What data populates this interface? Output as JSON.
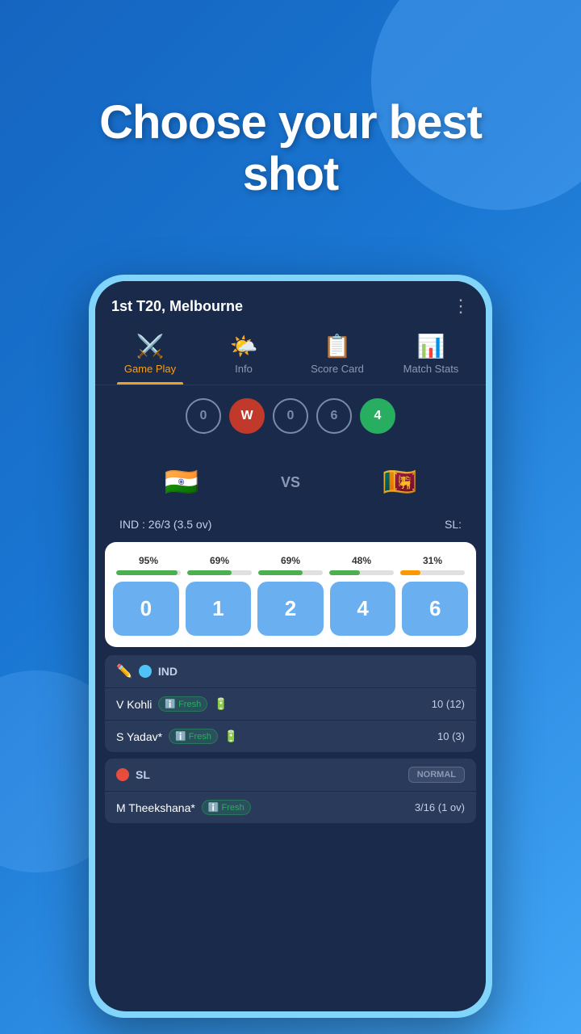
{
  "hero": {
    "line1": "Choose your best",
    "line2": "shot"
  },
  "match": {
    "title": "1st T20, Melbourne",
    "menu_icon": "⋮"
  },
  "tabs": [
    {
      "id": "game-play",
      "label": "Game Play",
      "icon": "🏏",
      "active": true
    },
    {
      "id": "info",
      "label": "Info",
      "icon": "🌤️",
      "active": false
    },
    {
      "id": "score-card",
      "label": "Score Card",
      "icon": "📋",
      "active": false
    },
    {
      "id": "match-stats",
      "label": "Match Stats",
      "icon": "📊",
      "active": false
    }
  ],
  "balls": [
    {
      "value": "0",
      "type": "zero"
    },
    {
      "value": "W",
      "type": "wicket"
    },
    {
      "value": "0",
      "type": "zero"
    },
    {
      "value": "6",
      "type": "number"
    },
    {
      "value": "4",
      "type": "six"
    }
  ],
  "teams": {
    "home": {
      "flag": "🇮🇳",
      "name": "IND",
      "score": "IND : 26/3 (3.5 ov)"
    },
    "away": {
      "flag": "🇱🇰",
      "name": "SL",
      "score": "SL:"
    },
    "vs": "VS"
  },
  "shots": [
    {
      "value": "0",
      "pct": "95%",
      "pct_num": 95,
      "orange": false
    },
    {
      "value": "1",
      "pct": "69%",
      "pct_num": 69,
      "orange": false
    },
    {
      "value": "2",
      "pct": "69%",
      "pct_num": 69,
      "orange": false
    },
    {
      "value": "4",
      "pct": "48%",
      "pct_num": 48,
      "orange": false
    },
    {
      "value": "6",
      "pct": "31%",
      "pct_num": 31,
      "orange": true
    }
  ],
  "ind_section": {
    "team": "IND",
    "dot_color": "#4fc3f7",
    "players": [
      {
        "name": "V Kohli",
        "score": "10 (12)",
        "fresh": true
      },
      {
        "name": "S Yadav*",
        "score": "10 (3)",
        "fresh": true
      }
    ]
  },
  "sl_section": {
    "team": "SL",
    "dot_color": "#e74c3c",
    "badge": "NORMAL",
    "players": [
      {
        "name": "M Theekshana*",
        "score": "3/16 (1 ov)",
        "fresh": true
      }
    ]
  }
}
